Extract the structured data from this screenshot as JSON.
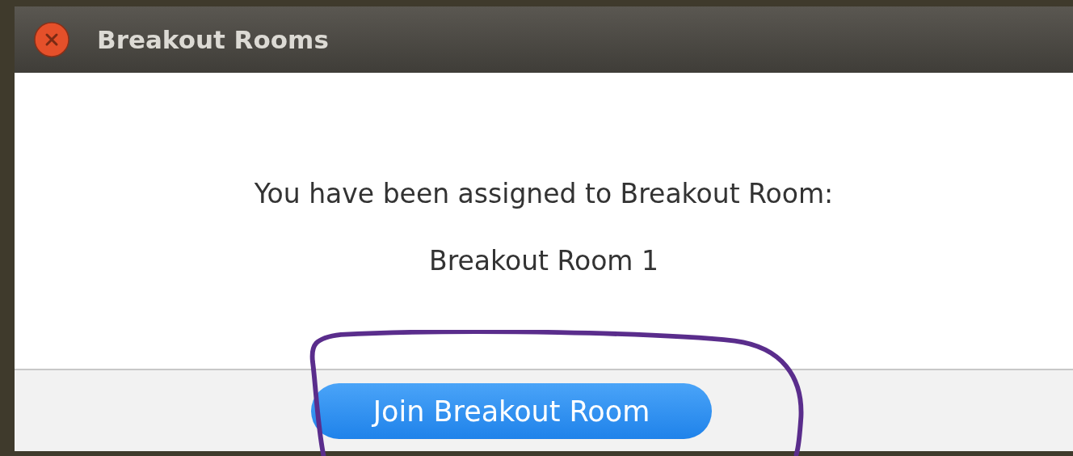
{
  "window": {
    "title": "Breakout Rooms"
  },
  "dialog": {
    "message": "You have been assigned to Breakout Room:",
    "room_name": "Breakout Room 1"
  },
  "footer": {
    "button": {
      "label": "Join Breakout Room"
    }
  }
}
